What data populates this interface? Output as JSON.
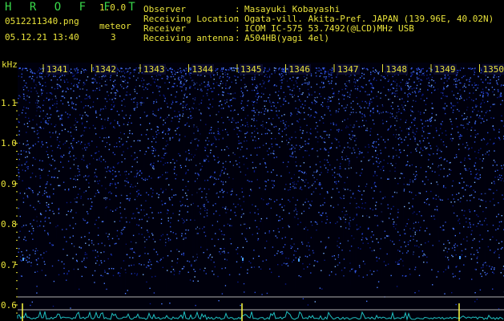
{
  "header": {
    "app_title": "H R O F F T",
    "app_version": "1.0.0",
    "file_name": "0512211340.png",
    "meteor_label": "meteor",
    "meteor_count": "3",
    "date_time": "05.12.21 13:40"
  },
  "observation": [
    {
      "key": "Observer",
      "sep": ":",
      "value": "Masayuki Kobayashi"
    },
    {
      "key": "Receiving Location",
      "sep": ":",
      "value": "Ogata-vill. Akita-Pref. JAPAN (139.96E, 40.02N)"
    },
    {
      "key": "Receiver",
      "sep": ":",
      "value": "ICOM IC-575 53.7492(@LCD)MHz USB"
    },
    {
      "key": "Receiving antenna",
      "sep": ":",
      "value": "A504HB(yagi 4el)"
    }
  ],
  "chart_data": {
    "type": "heatmap",
    "ylabel": "kHz",
    "y_ticks": [
      "1.1",
      "1.0",
      "0.9",
      "0.8",
      "0.7",
      "0.6"
    ],
    "y_tick_values": [
      1.1,
      1.0,
      0.9,
      0.8,
      0.7,
      0.6
    ],
    "x_ticks": [
      "1341",
      "1342",
      "1343",
      "1344",
      "1345",
      "1346",
      "1347",
      "1348",
      "1349",
      "1350"
    ],
    "ylim": [
      0.58,
      1.2
    ],
    "colors": {
      "noise_low": "#0a1a8a",
      "noise_high": "#4a7aff",
      "meteor": "#ffff40",
      "trace": "#20c0c0",
      "guide": "#b0b0b0"
    }
  }
}
